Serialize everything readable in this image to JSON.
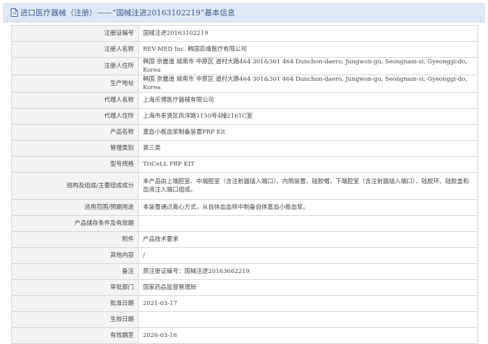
{
  "header": {
    "icon": "document-icon",
    "title": "进口医疗器械（注册）——“国械注进20163102219”基本信息"
  },
  "rows": [
    {
      "label": "注册证编号",
      "value": "国械注进20163102219"
    },
    {
      "label": "注册人名称",
      "value": "REV-MED Inc. 韩国蕊维医疗有限公司"
    },
    {
      "label": "注册人住所",
      "value": "韩国 京畿道 城南市 中原区 道村大路464 301&301 464 Dunchon-daero, Jungwon-gu, Seongnam-si, Gyeonggi-do, Korea"
    },
    {
      "label": "生产地址",
      "value": "韩国 京畿道 城南市 中原区 道村大路464 301&301 464 Dunchon-daero, Jungwon-gu, Seongnam-si, Gyeonggi-do, Korea"
    },
    {
      "label": "代理人名称",
      "value": "上海乐博医疗器械有限公司"
    },
    {
      "label": "代理人住所",
      "value": "上海市奉贤区凤洋路1150号4幢2161C室"
    },
    {
      "label": "产品名称",
      "value": "富血小板血浆制备装置PRP Kit"
    },
    {
      "label": "管理类别",
      "value": "第三类"
    },
    {
      "label": "型号规格",
      "value": "TriCeLL PRP KIT"
    },
    {
      "label": "结构及组成/主要组成成分",
      "value": "本产品由上端腔室、中端腔室（含注射器插入端口）、内筒装置、硅胶帽、下端腔室（含注射器插入端口）、硅胶环、硅胶盖和血液注入端口组成。"
    },
    {
      "label": "适用范围/预期用途",
      "value": "本装置通过离心方式，从自体血血样中制备自体富血小板血浆。"
    },
    {
      "label": "产品储存条件及有效期",
      "value": ""
    },
    {
      "label": "附件",
      "value": "产品技术要求"
    },
    {
      "label": "其他内容",
      "value": "/"
    },
    {
      "label": "备注",
      "value": "原注册证编号：国械注进20163662219"
    },
    {
      "label": "审批部门",
      "value": "国家药品监督管理局"
    },
    {
      "label": "批准日期",
      "value": "2021-03-17"
    },
    {
      "label": "生效日期",
      "value": ""
    },
    {
      "label": "有效期至",
      "value": "2026-03-16"
    }
  ]
}
